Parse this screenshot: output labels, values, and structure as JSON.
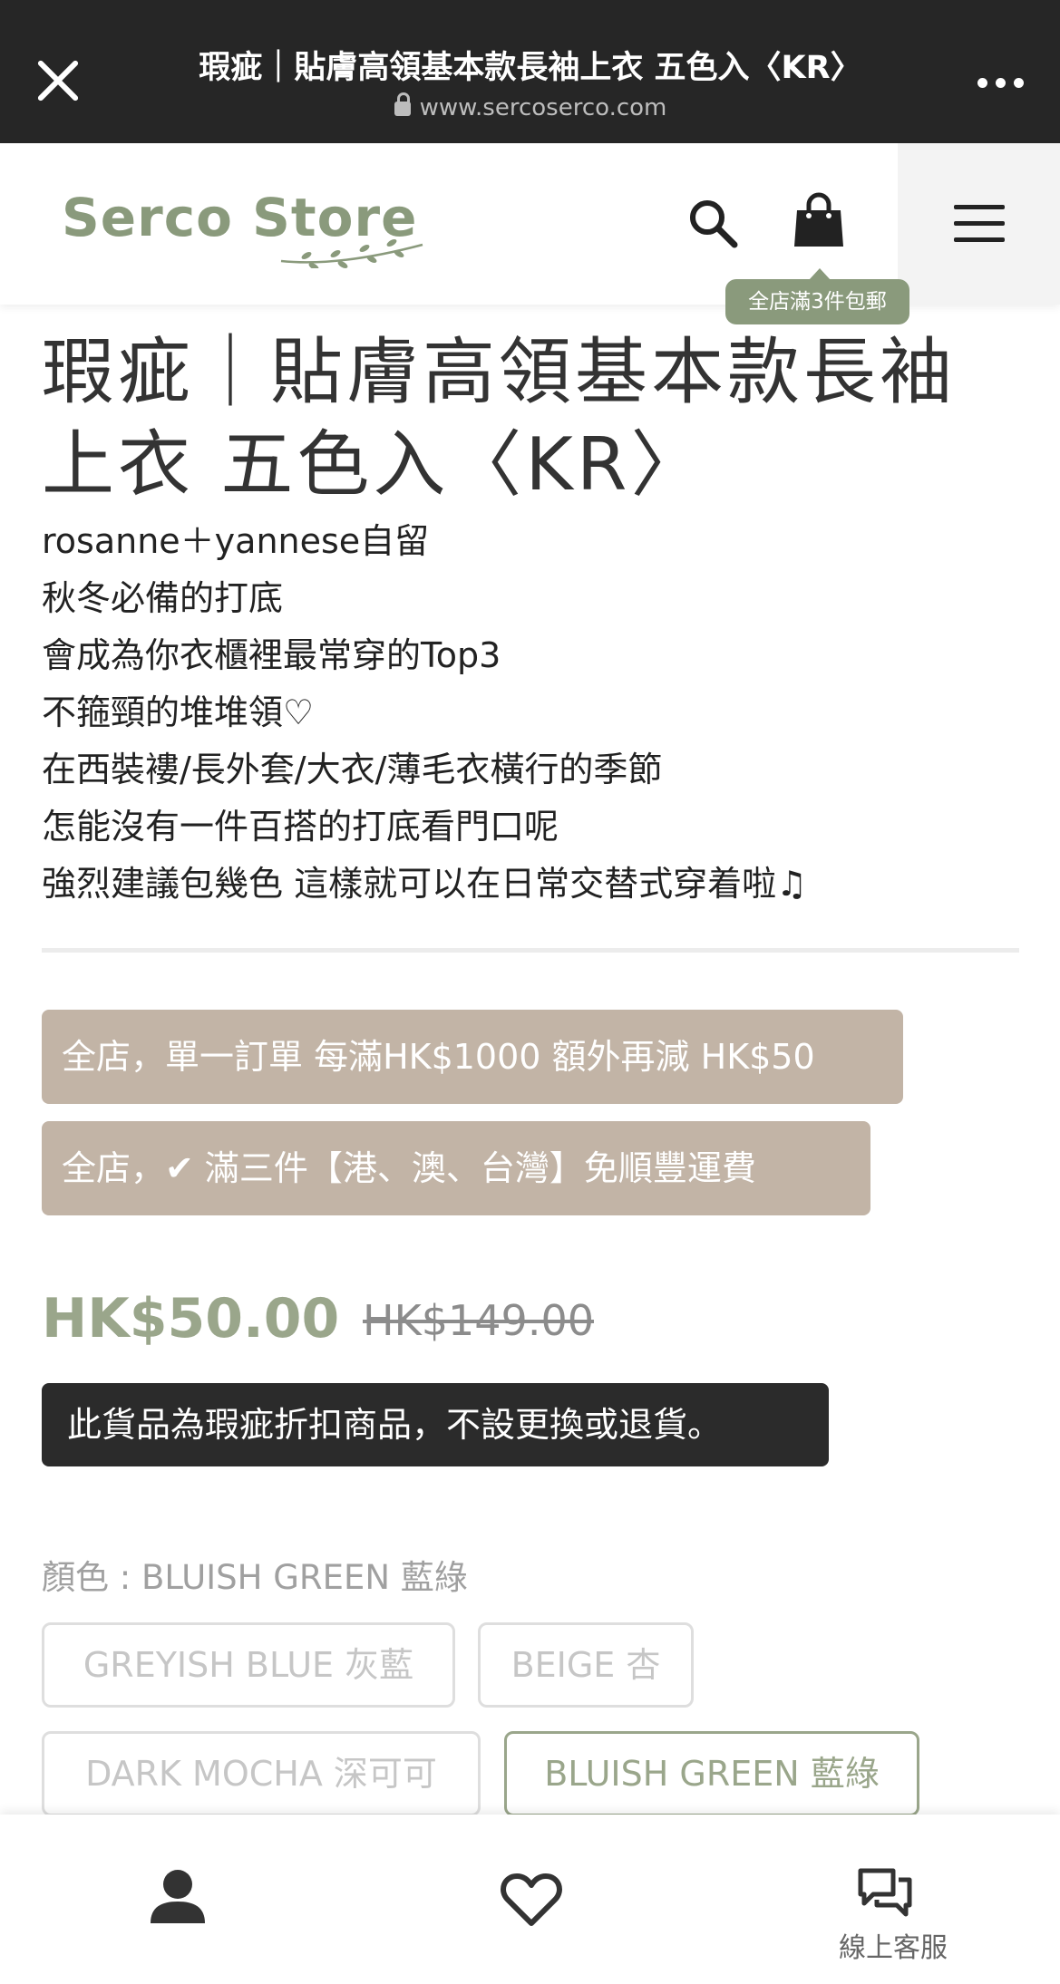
{
  "browser": {
    "page_title": "瑕疵｜貼膚高領基本款長袖上衣 五色入〈KR〉",
    "url": "www.sercoserco.com"
  },
  "header": {
    "logo_text": "Serco Store",
    "promo_bubble": "全店滿3件包郵"
  },
  "product": {
    "title": "瑕疵｜貼膚高領基本款長袖上衣 五色入〈KR〉",
    "description_lines": [
      "rosanne＋yannese自留",
      "秋冬必備的打底",
      "會成為你衣櫃裡最常穿的Top3",
      "不箍頸的堆堆領♡",
      "在西裝褸/長外套/大衣/薄毛衣橫行的季節",
      "怎能沒有一件百搭的打底看門口呢",
      "強烈建議包幾色 這樣就可以在日常交替式穿着啦♫"
    ],
    "promos": [
      "全店，單一訂單 每滿HK$1000 額外再減 HK$50",
      "全店，✔ 滿三件【港、澳、台灣】免順豐運費"
    ],
    "price_now": "HK$50.00",
    "price_was": "HK$149.00",
    "notice": "此貨品為瑕疵折扣商品，不設更換或退貨。",
    "color_label": "顏色 : BLUISH GREEN 藍綠",
    "color_options": [
      "GREYISH BLUE 灰藍",
      "BEIGE 杏",
      "DARK MOCHA 深可可",
      "BLUISH GREEN 藍綠"
    ],
    "selected_color": "BLUISH GREEN 藍綠"
  },
  "bottom_nav": {
    "chat_label": "線上客服"
  },
  "colors": {
    "accent": "#8a9a7c",
    "price": "#9aa68b",
    "promo_bg": "#c2b4a6",
    "notice_bg": "#2b2b2b",
    "topbar_bg": "#262626"
  },
  "icons": [
    "close-icon",
    "lock-icon",
    "more-icon",
    "search-icon",
    "cart-icon",
    "menu-icon",
    "profile-icon",
    "heart-icon",
    "chat-icon"
  ]
}
